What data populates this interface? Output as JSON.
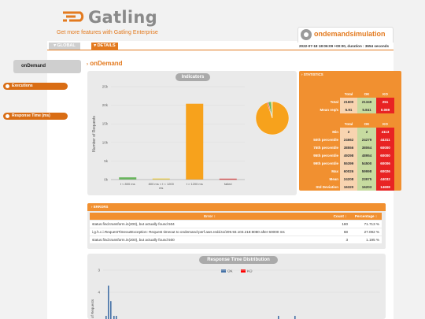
{
  "header": {
    "logo_text": "Gatling",
    "enterprise_link": "Get more features with Gatling Enterprise",
    "simulation_name": "ondemandsimulation",
    "run_info": "2022-07-18 18:06:09 +00:00, duration : 3654 seconds"
  },
  "tabs": {
    "global": "GLOBAL",
    "details": "DETAILS"
  },
  "sidebar": {
    "items": [
      {
        "label": "onDemand"
      }
    ]
  },
  "request": {
    "title": "onDemand"
  },
  "indicators": {
    "title": "Indicators"
  },
  "statistics": {
    "heading": "STATISTICS",
    "executions_label": "Executions",
    "response_time_label": "Response Time (ms)",
    "columns": [
      "Total",
      "OK",
      "KO"
    ],
    "executions": [
      {
        "label": "Total",
        "total": "21600",
        "ok": "21349",
        "ko": "251"
      },
      {
        "label": "Mean req/s",
        "total": "5.91",
        "ok": "5.841",
        "ko": "0.069"
      }
    ],
    "response_time": [
      {
        "label": "Min",
        "total": "2",
        "ok": "2",
        "ko": "4113"
      },
      {
        "label": "50th percentile",
        "total": "24662",
        "ok": "24279",
        "ko": "44311"
      },
      {
        "label": "75th percentile",
        "total": "38556",
        "ok": "38064",
        "ko": "60000"
      },
      {
        "label": "95th percentile",
        "total": "49298",
        "ok": "48954",
        "ko": "60000"
      },
      {
        "label": "99th percentile",
        "total": "55399",
        "ok": "54500",
        "ko": "60006"
      },
      {
        "label": "Max",
        "total": "60026",
        "ok": "59998",
        "ko": "60026"
      },
      {
        "label": "Mean",
        "total": "24208",
        "ok": "23975",
        "ko": "44032"
      },
      {
        "label": "Std Deviation",
        "total": "16320",
        "ok": "16203",
        "ko": "14608"
      }
    ]
  },
  "errors": {
    "heading": "ERRORS",
    "columns": {
      "error": "Error ↕",
      "count": "Count ↕",
      "percentage": "Percentage ↕"
    },
    "rows": [
      {
        "error": "status.find.transform.in(200), but actually found 504",
        "count": "180",
        "percentage": "71.713 %"
      },
      {
        "error": "i.g.h.c.i.RequestTimeoutException: Request timeout to ondemand-perf.aws.redd.to/209.93.103.218:8080 after 60000 ms",
        "count": "68",
        "percentage": "27.092 %"
      },
      {
        "error": "status.find.transform.in(200), but actually found 500",
        "count": "3",
        "percentage": "1.195 %"
      }
    ]
  },
  "distribution": {
    "title": "Response Time Distribution",
    "legend_ok": "OK",
    "legend_ko": "KO"
  },
  "colors": {
    "accent": "#e37a1f",
    "ok": "#4572a7",
    "ko": "#ff0000",
    "bar_green": "#68b65c",
    "bar_yellow": "#f0d040",
    "bar_orange": "#f7a21c",
    "bar_red": "#e84040"
  },
  "chart_data": [
    {
      "type": "bar",
      "categories": [
        "t < 800 ms",
        "800 ms < t < 1200 ms",
        "t > 1200 ms",
        "failed"
      ],
      "values": [
        600,
        290,
        20400,
        251
      ],
      "ylabel": "Number of Requests",
      "ylim": [
        0,
        25000
      ],
      "yticks": [
        "0k",
        "5k",
        "10k",
        "15k",
        "20k",
        "25k"
      ],
      "grid": true
    },
    {
      "type": "pie",
      "categories": [
        "t < 800 ms",
        "800 ms < t < 1200 ms",
        "t > 1200 ms",
        "failed"
      ],
      "values": [
        600,
        290,
        20400,
        251
      ]
    },
    {
      "type": "bar",
      "title": "Response Time Distribution",
      "ylabel": "of Requests",
      "ylim": [
        0,
        4
      ],
      "yticks": [
        "3",
        "4"
      ],
      "series": [
        {
          "name": "OK",
          "values": [
            1,
            3.3,
            2.6,
            1,
            1.3,
            1,
            1
          ]
        },
        {
          "name": "KO",
          "values": []
        }
      ]
    }
  ]
}
